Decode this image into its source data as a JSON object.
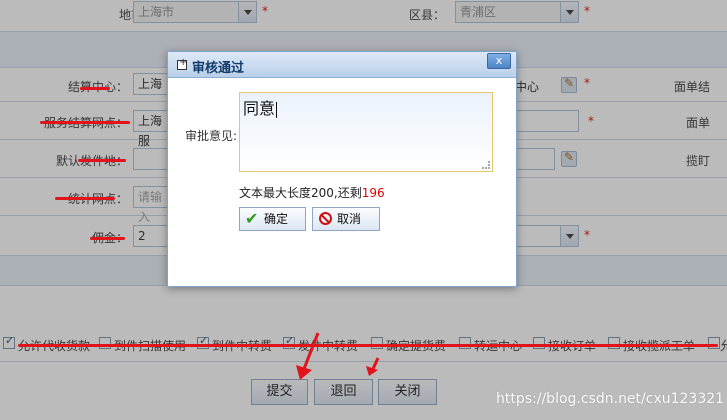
{
  "form": {
    "city_label": "地市：",
    "city_value": "上海市",
    "district_label": "区县：",
    "district_value": "青浦区",
    "settle_center_label": "结算中心：",
    "settle_center_value": "上海",
    "settle_center_right_value": "中心",
    "face_single_label": "面单结",
    "service_point_label": "服务结算网点：",
    "service_point_value": "上海服",
    "face_single_label2": "面单",
    "default_label": "默认发件地：",
    "pickup_label": "揽盯",
    "stat_point_label": "统计网点：",
    "stat_point_placeholder": "请输入",
    "commission_label": "佣金：",
    "commission_value": "2",
    "required_mark": "*"
  },
  "checkboxes": [
    {
      "label": "允许代收货款",
      "checked": true
    },
    {
      "label": "到件扫描使用",
      "checked": false
    },
    {
      "label": "到件中转费",
      "checked": true
    },
    {
      "label": "发件中转费",
      "checked": true
    },
    {
      "label": "确定提货费",
      "checked": false
    },
    {
      "label": "转运中心",
      "checked": false
    },
    {
      "label": "接收订单",
      "checked": false
    },
    {
      "label": "接收揽派工单",
      "checked": false
    },
    {
      "label": "允",
      "checked": false
    }
  ],
  "buttons": {
    "submit": "提交",
    "return": "退回",
    "close": "关闭"
  },
  "dialog": {
    "title": "审核通过",
    "close_glyph": "x",
    "opinion_label": "审批意见:",
    "opinion_value": "同意",
    "hint_prefix": "文本最大长度200,还剩",
    "hint_remaining": "196",
    "confirm": "确定",
    "cancel": "取消"
  },
  "watermark": "https://blog.csdn.net/cxu123321",
  "colors": {
    "accent_red": "#e00000",
    "title_blue": "#123a6b",
    "border_blue": "#7fa3c9"
  }
}
